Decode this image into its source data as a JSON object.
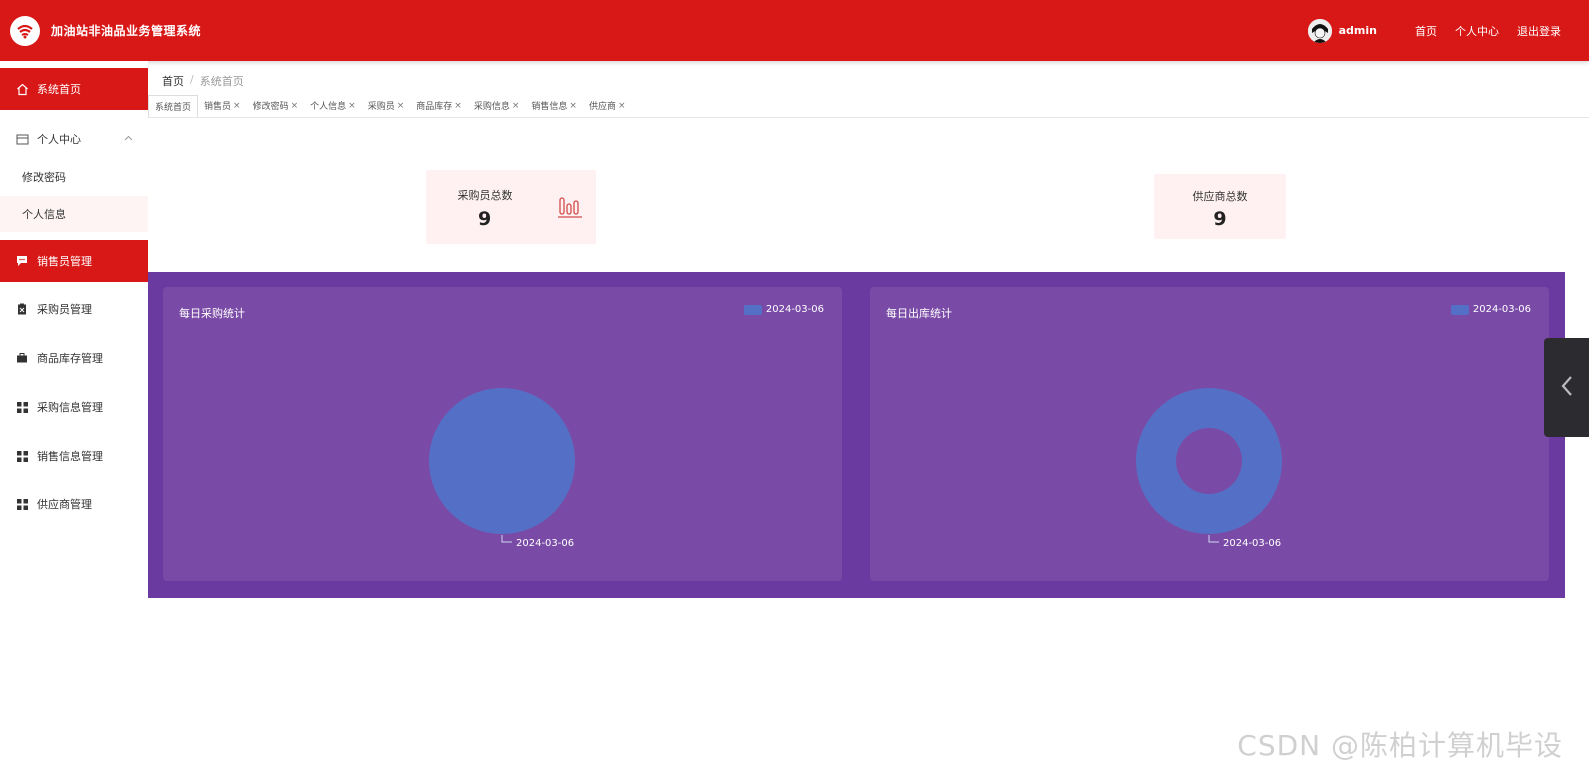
{
  "header": {
    "app_title": "加油站非油品业务管理系统",
    "username": "admin",
    "links": [
      "首页",
      "个人中心",
      "退出登录"
    ]
  },
  "sidebar": {
    "items": [
      {
        "label": "系统首页",
        "icon": "home-icon",
        "active": true
      },
      {
        "label": "个人中心",
        "icon": "profile-card-icon",
        "expanded": true,
        "children": [
          {
            "label": "修改密码"
          },
          {
            "label": "个人信息"
          }
        ]
      },
      {
        "label": "销售员管理",
        "icon": "chat-icon",
        "active": true
      },
      {
        "label": "采购员管理",
        "icon": "clipboard-icon"
      },
      {
        "label": "商品库存管理",
        "icon": "briefcase-icon"
      },
      {
        "label": "采购信息管理",
        "icon": "grid-icon"
      },
      {
        "label": "销售信息管理",
        "icon": "grid-icon"
      },
      {
        "label": "供应商管理",
        "icon": "grid-icon"
      }
    ]
  },
  "breadcrumb": {
    "home": "首页",
    "separator": "/",
    "current": "系统首页"
  },
  "tabs": [
    "系统首页",
    "销售员",
    "修改密码",
    "个人信息",
    "采购员",
    "商品库存",
    "采购信息",
    "销售信息",
    "供应商"
  ],
  "stats": [
    {
      "label": "采购员总数",
      "value": "9"
    },
    {
      "label": "供应商总数",
      "value": "9"
    }
  ],
  "charts": [
    {
      "title": "每日采购统计",
      "legend": "2024-03-06"
    },
    {
      "title": "每日出库统计",
      "legend": "2024-03-06"
    }
  ],
  "chart_data": [
    {
      "type": "pie",
      "title": "每日采购统计",
      "categories": [
        "2024-03-06"
      ],
      "values": [
        1
      ],
      "legend": "top-right",
      "color": "#5470c6"
    },
    {
      "type": "pie",
      "title": "每日出库统计",
      "categories": [
        "2024-03-06"
      ],
      "values": [
        1
      ],
      "legend": "top-right",
      "donut": true,
      "color": "#5470c6"
    }
  ],
  "colors": {
    "primary": "#d81717",
    "purple_bg": "#6a3aa0",
    "panel_bg": "#7a4ba6",
    "series": "#5470c6",
    "stat_bg": "#fff1f1"
  },
  "watermark": "CSDN @陈柏计算机毕设"
}
